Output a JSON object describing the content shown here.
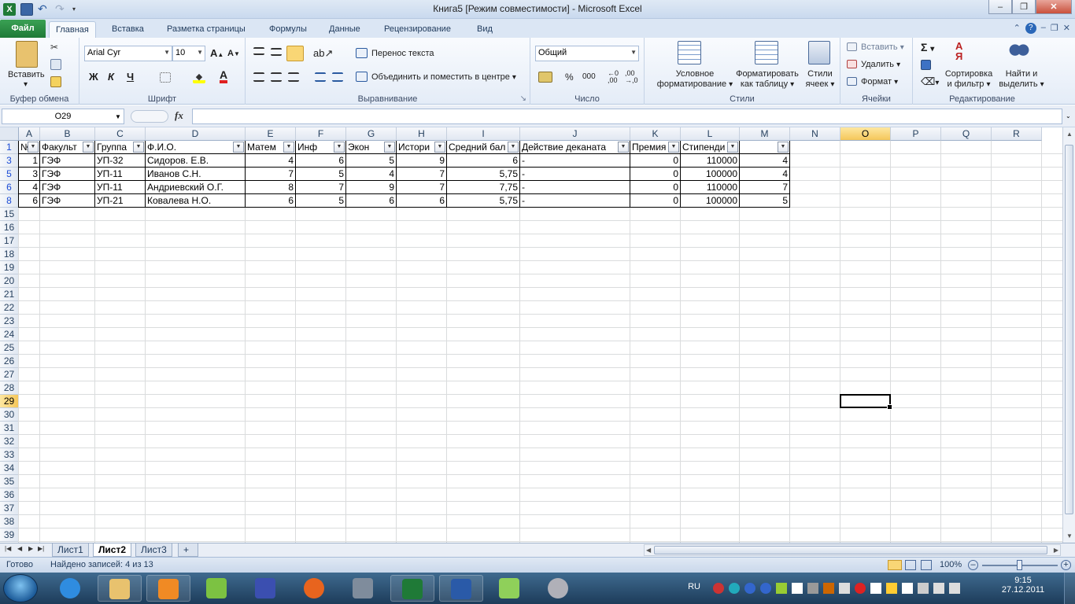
{
  "window": {
    "title": "Книга5  [Режим совместимости]  -  Microsoft Excel"
  },
  "ribbon_tabs": {
    "file": "Файл",
    "tabs": [
      "Главная",
      "Вставка",
      "Разметка страницы",
      "Формулы",
      "Данные",
      "Рецензирование",
      "Вид"
    ],
    "active": "Главная"
  },
  "ribbon": {
    "clipboard": {
      "paste": "Вставить",
      "label": "Буфер обмена"
    },
    "font": {
      "name": "Arial Cyr",
      "size": "10",
      "bold": "Ж",
      "italic": "К",
      "underline": "Ч",
      "label": "Шрифт"
    },
    "alignment": {
      "wrap": "Перенос текста",
      "merge": "Объединить и поместить в центре",
      "label": "Выравнивание"
    },
    "number": {
      "format": "Общий",
      "percent": "%",
      "thousands": "000",
      "label": "Число"
    },
    "styles": {
      "conditional": [
        "Условное",
        "форматирование"
      ],
      "as_table": [
        "Форматировать",
        "как таблицу"
      ],
      "cell_styles": [
        "Стили",
        "ячеек"
      ],
      "label": "Стили"
    },
    "cells": {
      "insert": "Вставить",
      "delete": "Удалить",
      "format": "Формат",
      "label": "Ячейки"
    },
    "editing": {
      "sort": [
        "Сортировка",
        "и фильтр"
      ],
      "find": [
        "Найти и",
        "выделить"
      ],
      "label": "Редактирование"
    }
  },
  "formula_bar": {
    "name_box": "O29",
    "fx": "fx",
    "formula": ""
  },
  "grid": {
    "columns": [
      "A",
      "B",
      "C",
      "D",
      "E",
      "F",
      "G",
      "H",
      "I",
      "J",
      "K",
      "L",
      "M",
      "N",
      "O",
      "P",
      "Q",
      "R"
    ],
    "selected_column": "O",
    "rows": [
      "1",
      "3",
      "5",
      "6",
      "8",
      "15",
      "16",
      "17",
      "18",
      "19",
      "20",
      "21",
      "22",
      "23",
      "24",
      "25",
      "26",
      "27",
      "28",
      "29",
      "30",
      "31",
      "32",
      "33",
      "34",
      "35",
      "36",
      "37",
      "38",
      "39"
    ],
    "filtered_rows": [
      "1",
      "3",
      "5",
      "6",
      "8"
    ],
    "selected_row": "29",
    "headers": [
      "№",
      "Факульт",
      "Группа",
      "Ф.И.О.",
      "Матем",
      "Инф",
      "Экон",
      "Истори",
      "Средний бал",
      "Действие деканата",
      "Премия",
      "Стипенди",
      ""
    ],
    "data": [
      [
        "1",
        "ГЭФ",
        "УП-32",
        "Сидоров. Е.В.",
        "4",
        "6",
        "5",
        "9",
        "6",
        "-",
        "0",
        "110000",
        "4"
      ],
      [
        "3",
        "ГЭФ",
        "УП-11",
        "Иванов С.Н.",
        "7",
        "5",
        "4",
        "7",
        "5,75",
        "-",
        "0",
        "100000",
        "4"
      ],
      [
        "4",
        "ГЭФ",
        "УП-11",
        "Андриевский О.Г.",
        "8",
        "7",
        "9",
        "7",
        "7,75",
        "-",
        "0",
        "110000",
        "7"
      ],
      [
        "6",
        "ГЭФ",
        "УП-21",
        "Ковалева Н.О.",
        "6",
        "5",
        "6",
        "6",
        "5,75",
        "-",
        "0",
        "100000",
        "5"
      ]
    ]
  },
  "sheets": {
    "tabs": [
      "Лист1",
      "Лист2",
      "Лист3"
    ],
    "active": "Лист2"
  },
  "status": {
    "ready": "Готово",
    "records": "Найдено записей: 4 из 13",
    "zoom": "100%"
  },
  "taskbar": {
    "lang": "RU",
    "time": "9:15",
    "date": "27.12.2011",
    "apps": [
      "internet-explorer",
      "file-explorer",
      "media-player",
      "icq",
      "floppy-save",
      "firefox",
      "m-app",
      "excel",
      "word",
      "v-app",
      "dvd-player"
    ]
  },
  "colors": {
    "excel_green": "#1f7a37",
    "selection_orange": "#f5c75a",
    "ribbon_blue": "#dbe6f4",
    "filtered_row_blue": "#1a4bd6"
  }
}
